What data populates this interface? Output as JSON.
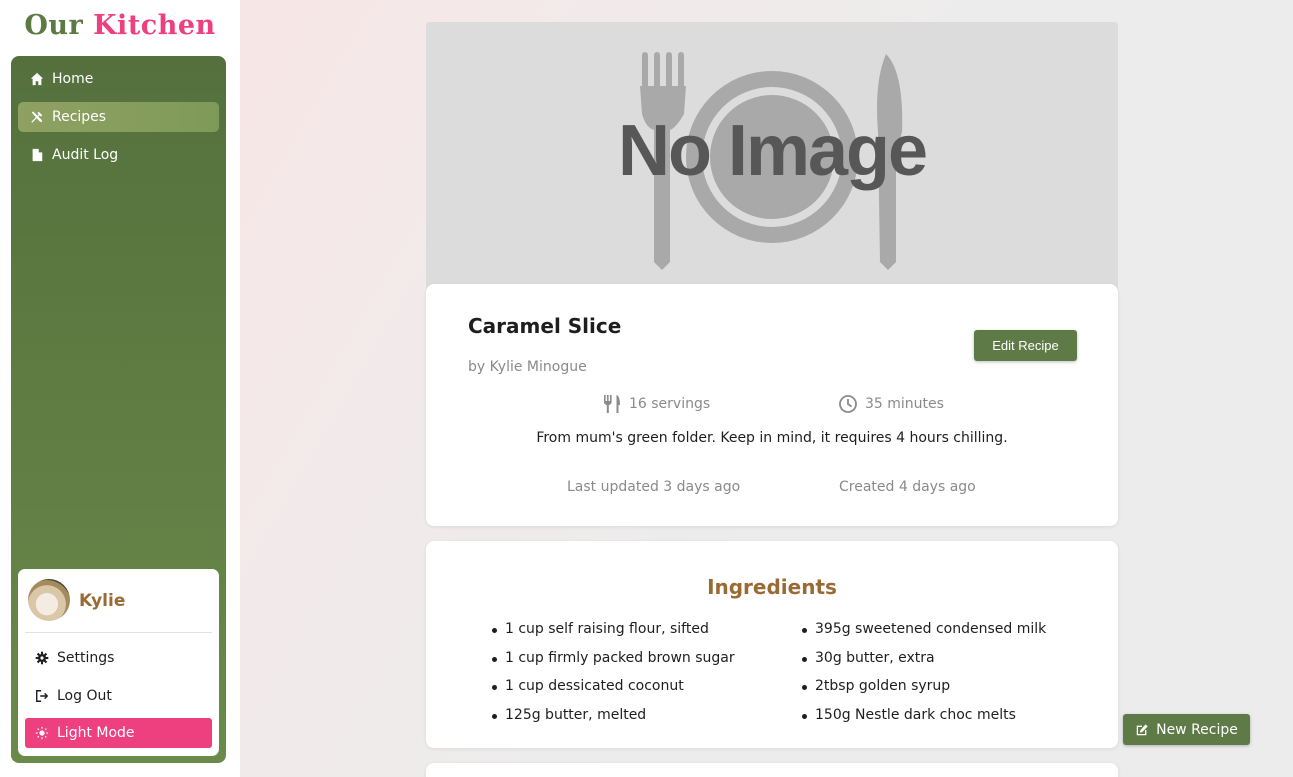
{
  "brand": {
    "word1": "Our",
    "word2": "Kitchen"
  },
  "nav": {
    "items": [
      {
        "label": "Home",
        "icon": "home-icon"
      },
      {
        "label": "Recipes",
        "icon": "utensils-crossed-icon",
        "active": true
      },
      {
        "label": "Audit Log",
        "icon": "file-icon"
      }
    ]
  },
  "user": {
    "name": "Kylie",
    "menu": [
      {
        "label": "Settings",
        "icon": "gear-icon"
      },
      {
        "label": "Log Out",
        "icon": "logout-icon"
      },
      {
        "label": "Light Mode",
        "icon": "sun-icon"
      }
    ]
  },
  "hero": {
    "placeholder_text": "No Image"
  },
  "recipe": {
    "title": "Caramel Slice",
    "author": "by Kylie Minogue",
    "edit_label": "Edit Recipe",
    "servings": "16 servings",
    "time": "35 minutes",
    "description": "From mum's green folder. Keep in mind, it requires 4 hours chilling.",
    "last_updated": "Last updated 3 days ago",
    "created": "Created 4 days ago"
  },
  "ingredients": {
    "title": "Ingredients",
    "left": [
      "1 cup self raising flour, sifted",
      "1 cup firmly packed brown sugar",
      "1 cup dessicated coconut",
      "125g butter, melted"
    ],
    "right": [
      "395g sweetened condensed milk",
      "30g butter, extra",
      "2tbsp golden syrup",
      "150g Nestle dark choc melts"
    ]
  },
  "actions": {
    "new_recipe_label": "New Recipe"
  },
  "colors": {
    "brand_green": "#5e7b47",
    "brand_pink": "#ee3f7e",
    "accent_brown": "#9a6a35"
  }
}
